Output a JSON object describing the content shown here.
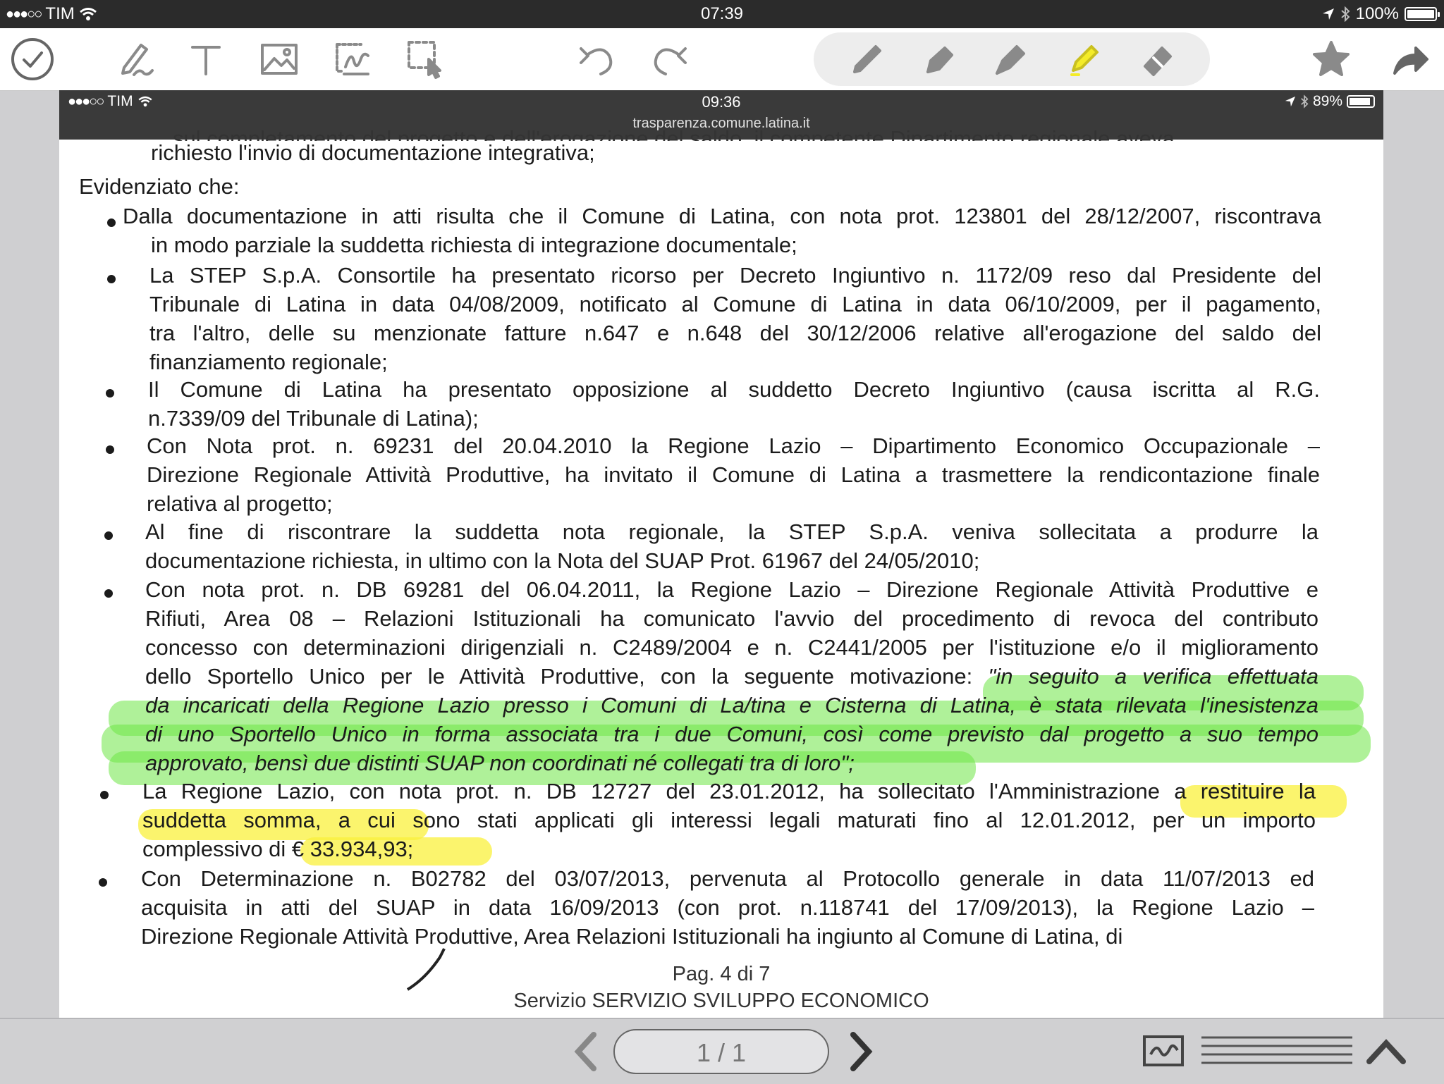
{
  "statusbar": {
    "carrier": "TIM",
    "time": "07:39",
    "battery": "100%",
    "battery_level": 1.0
  },
  "toolbar": {
    "tools": [
      "done",
      "draw",
      "text",
      "image",
      "signature",
      "select",
      "undo",
      "redo"
    ],
    "pens": [
      "pen",
      "fountain-pen",
      "nib-pen",
      "highlighter",
      "eraser"
    ],
    "right": [
      "favorite",
      "share"
    ]
  },
  "embedded": {
    "carrier": "TIM",
    "time": "09:36",
    "url": "trasparenza.comune.latina.it",
    "battery": "89%",
    "battery_level": 0.89
  },
  "doc": {
    "cut_line": "…sul completamento del progetto e dell'erogazione del saldo, il competente Dipartimento regionale aveva",
    "line_richiesto": "richiesto l'invio di documentazione integrativa;",
    "evidenziato": "Evidenziato che:",
    "b1": [
      "Dalla documentazione in atti risulta che il Comune di Latina, con nota prot. 123801 del 28/12/2007, riscontrava",
      "in modo parziale la suddetta richiesta di integrazione documentale;"
    ],
    "b2": [
      "La STEP S.p.A. Consortile ha presentato ricorso per Decreto Ingiuntivo n. 1172/09 reso dal Presidente del",
      "Tribunale di Latina in data 04/08/2009, notificato al Comune di Latina in data 06/10/2009, per il pagamento,",
      "tra l'altro, delle su menzionate fatture n.647 e n.648 del 30/12/2006 relative all'erogazione del saldo del",
      "finanziamento regionale;"
    ],
    "b3": [
      "Il Comune di Latina ha presentato opposizione al suddetto Decreto Ingiuntivo (causa iscritta al R.G.",
      "n.7339/09 del Tribunale di Latina);"
    ],
    "b4": [
      "Con Nota prot. n. 69231 del 20.04.2010 la Regione Lazio – Dipartimento Economico Occupazionale –",
      "Direzione Regionale Attività Produttive, ha invitato il Comune di Latina a trasmettere la rendicontazione finale",
      "relativa al progetto;"
    ],
    "b5": [
      "Al fine di riscontrare la suddetta nota regionale, la STEP S.p.A. veniva sollecitata a produrre la",
      "documentazione richiesta, in ultimo con la Nota del SUAP Prot. 61967 del 24/05/2010;"
    ],
    "b6": [
      "Con nota prot. n. DB 69281 del 06.04.2011, la Regione Lazio – Direzione Regionale Attività Produttive e",
      "Rifiuti, Area 08 – Relazioni Istituzionali ha comunicato l'avvio del procedimento di revoca del contributo",
      "concesso con determinazioni dirigenziali n. C2489/2004 e n. C2441/2005 per l'istituzione e/o il miglioramento"
    ],
    "b6_l4a": "dello Sportello Unico per le Attività Produttive, con la seguente motivazione:",
    "b6_l4b": "\"in seguito a verifica effettuata",
    "b6_italic": [
      "da incaricati della Regione Lazio presso i Comuni di La/tina e Cisterna di Latina, è stata rilevata l'inesistenza",
      "di uno Sportello Unico in forma associata tra i due Comuni, così come previsto dal progetto a suo tempo",
      "approvato, bensì due distinti SUAP non coordinati né collegati tra di loro\";"
    ],
    "b7": [
      "La Regione Lazio, con nota prot. n. DB 12727 del 23.01.2012, ha sollecitato l'Amministrazione a restituire la",
      "suddetta somma, a cui sono stati applicati gli interessi legali maturati fino al 12.01.2012, per un importo",
      "complessivo di € 33.934,93;"
    ],
    "b8": [
      "Con Determinazione n. B02782 del 03/07/2013, pervenuta al Protocollo generale in data 11/07/2013 ed",
      "acquisita in atti del SUAP in data 16/09/2013 (con prot. n.118741 del 17/09/2013), la Regione Lazio –",
      "Direzione Regionale Attività Produttive, Area Relazioni Istituzionali  ha ingiunto al Comune di Latina, di"
    ],
    "page_num": "Pag. 4 di 7",
    "service": "Servizio  SERVIZIO SVILUPPO ECONOMICO"
  },
  "bottombar": {
    "page_indicator": "1 / 1"
  },
  "colors": {
    "highlight_green": "#6ee646",
    "highlight_yellow": "#faf03c",
    "icon_gray": "#8a8a8a"
  }
}
